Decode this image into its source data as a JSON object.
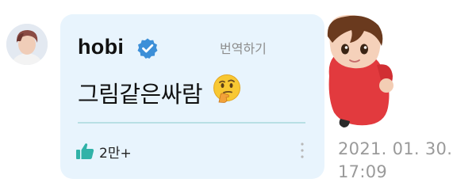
{
  "comment": {
    "username": "hobi",
    "translate_label": "번역하기",
    "text": "그림같은싸람",
    "like_count": "2만+",
    "timestamp": "2021. 01. 30. 17:09"
  },
  "colors": {
    "bubble_background": "#e8f4fd",
    "verified_badge": "#3c8fd8",
    "like_icon": "#31b2a8",
    "divider": "#b8dfe4",
    "timestamp_text": "#9a9a9a"
  },
  "icons": {
    "verified": "verified-badge-icon",
    "emoji": "thinking-face-emoji",
    "like": "thumbs-up-icon",
    "more": "vertical-dots-icon"
  }
}
